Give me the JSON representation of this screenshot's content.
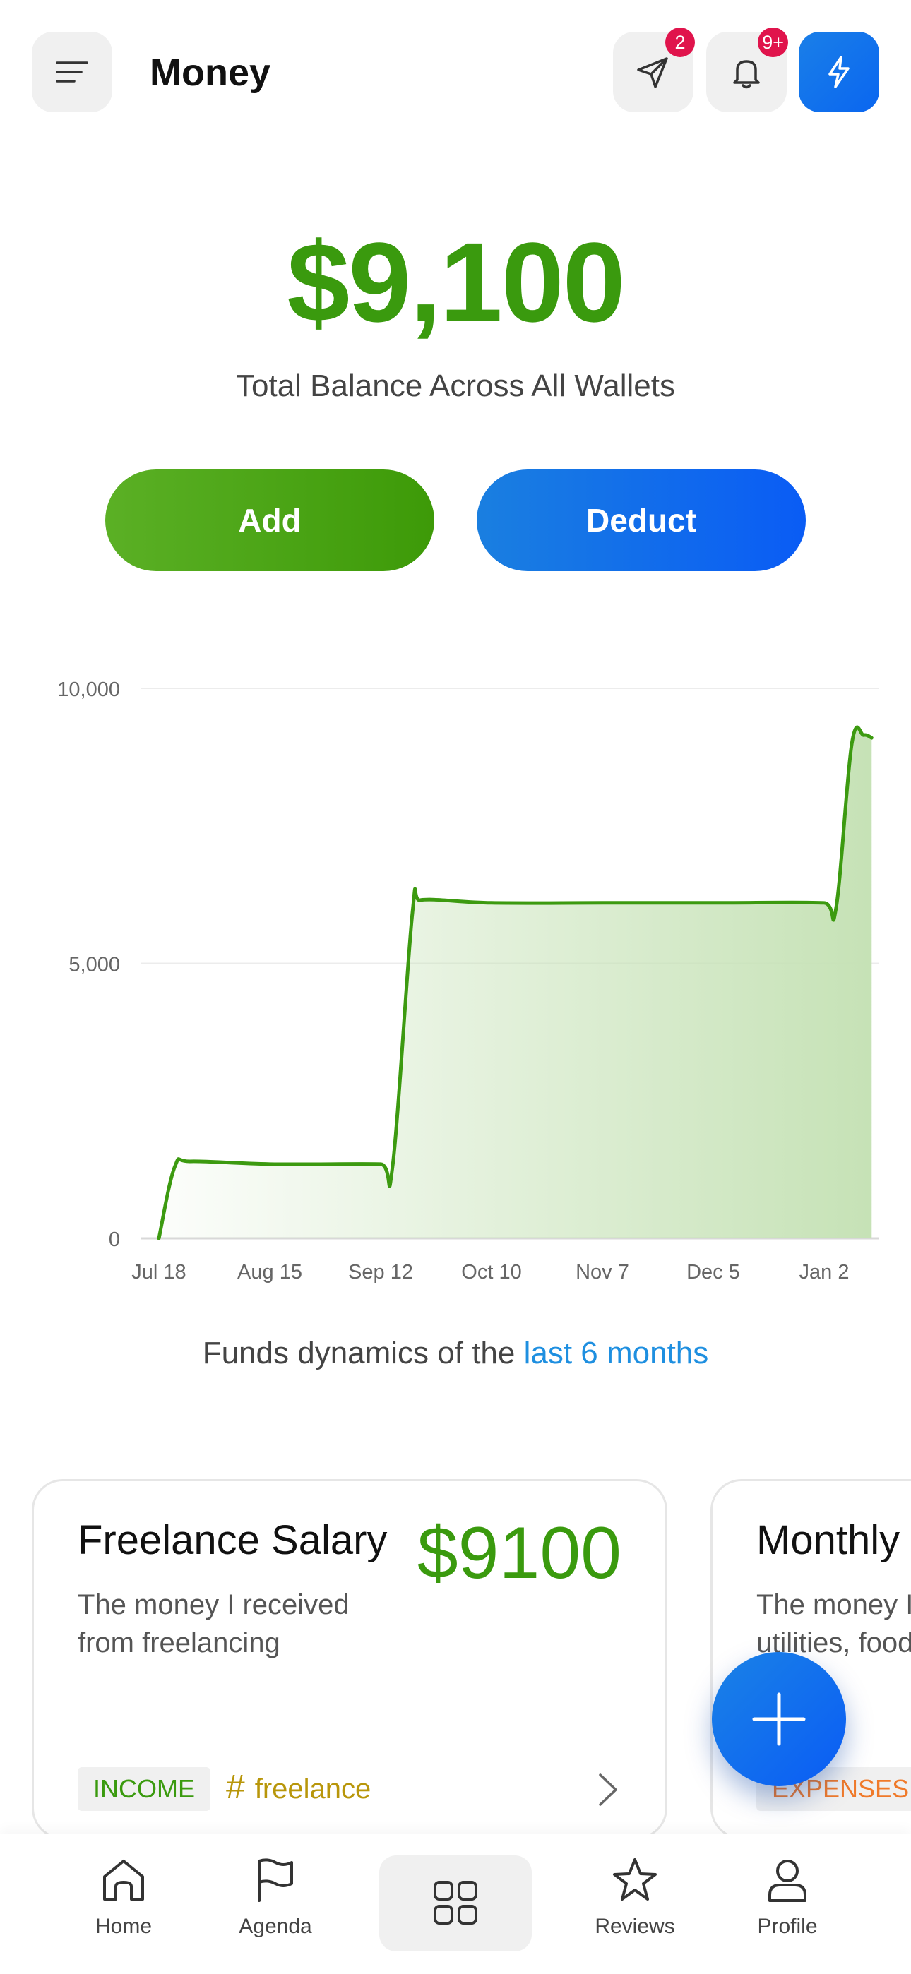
{
  "header": {
    "title": "Money",
    "send_badge": "2",
    "bell_badge": "9+"
  },
  "balance": {
    "amount": "$9,100",
    "subtitle": "Total Balance Across All Wallets"
  },
  "actions": {
    "add_label": "Add",
    "deduct_label": "Deduct"
  },
  "chart_data": {
    "type": "area",
    "y_ticks": [
      "10,000",
      "5,000",
      "0"
    ],
    "ylim": [
      0,
      10000
    ],
    "x_ticks": [
      "Jul 18",
      "Aug 15",
      "Sep 12",
      "Oct 10",
      "Nov 7",
      "Dec 5",
      "Jan 2"
    ],
    "series": [
      {
        "x": [
          "Jul 18",
          "Jul 22",
          "Jul 26",
          "Aug 15",
          "Sep 12",
          "Sep 15",
          "Sep 20",
          "Sep 22",
          "Oct 10",
          "Nov 7",
          "Dec 5",
          "Jan 2",
          "Jan 5",
          "Jan 9",
          "Jan 12",
          "Jan 14"
        ],
        "values": [
          0,
          1300,
          1400,
          1350,
          1350,
          1300,
          5900,
          6150,
          6100,
          6100,
          6100,
          6100,
          6000,
          9000,
          9150,
          9100
        ]
      }
    ],
    "grid": true,
    "line_color": "#3c9a10",
    "fill_color": "#c6e2b6"
  },
  "caption": {
    "prefix": "Funds dynamics of the ",
    "link": "last 6 months"
  },
  "cards": [
    {
      "title": "Freelance Salary",
      "amount": "$9100",
      "description": "The money I received from freelancing",
      "type_tag": "INCOME",
      "hashtag": "freelance"
    },
    {
      "title": "Monthly",
      "description_line1": "The money I",
      "description_line2": "utilities, food",
      "type_tag": "EXPENSES"
    }
  ],
  "nav": {
    "home": "Home",
    "agenda": "Agenda",
    "reviews": "Reviews",
    "profile": "Profile"
  },
  "colors": {
    "green": "#3a9a0e",
    "blue": "#0a66f0",
    "badge_red": "#e0144c",
    "link_blue": "#1e8fe0",
    "hashtag_gold": "#b8960a",
    "expense_orange": "#f07a2a"
  }
}
